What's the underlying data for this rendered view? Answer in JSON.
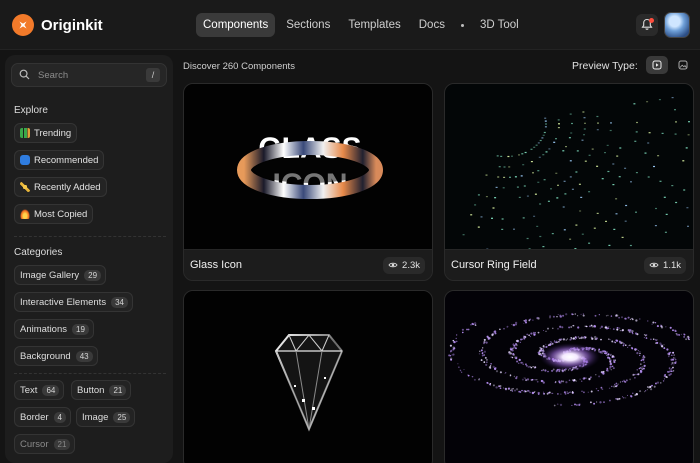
{
  "brand": {
    "name": "Originkit",
    "accent": "#f27a2a"
  },
  "nav": {
    "items": [
      {
        "label": "Components",
        "active": true
      },
      {
        "label": "Sections"
      },
      {
        "label": "Templates"
      },
      {
        "label": "Docs"
      },
      {
        "label": "3D Tool"
      }
    ]
  },
  "sidebar": {
    "search": {
      "placeholder": "Search",
      "shortcut": "/"
    },
    "explore_title": "Explore",
    "explore": [
      {
        "label": "Trending",
        "icon": "chart-icon"
      },
      {
        "label": "Recommended",
        "icon": "thumbs-up-icon"
      },
      {
        "label": "Recently Added",
        "icon": "sparkle-icon"
      },
      {
        "label": "Most Copied",
        "icon": "fire-icon"
      }
    ],
    "categories_title": "Categories",
    "categories": [
      {
        "label": "Image Gallery",
        "count": "29"
      },
      {
        "label": "Interactive Elements",
        "count": "34"
      },
      {
        "label": "Animations",
        "count": "19"
      },
      {
        "label": "Background",
        "count": "43"
      },
      {
        "label": "Text",
        "count": "64"
      },
      {
        "label": "Button",
        "count": "21"
      },
      {
        "label": "Border",
        "count": "4"
      },
      {
        "label": "Image",
        "count": "25"
      },
      {
        "label": "Cursor",
        "count": "21"
      }
    ]
  },
  "main": {
    "discover": "Discover 260 Components",
    "preview_type_label": "Preview Type:",
    "cards": [
      {
        "title": "Glass Icon",
        "views": "2.3k",
        "preview_text": "GLASS ICON"
      },
      {
        "title": "Cursor Ring Field",
        "views": "1.1k"
      },
      {
        "title": "",
        "views": ""
      },
      {
        "title": "",
        "views": ""
      }
    ]
  }
}
